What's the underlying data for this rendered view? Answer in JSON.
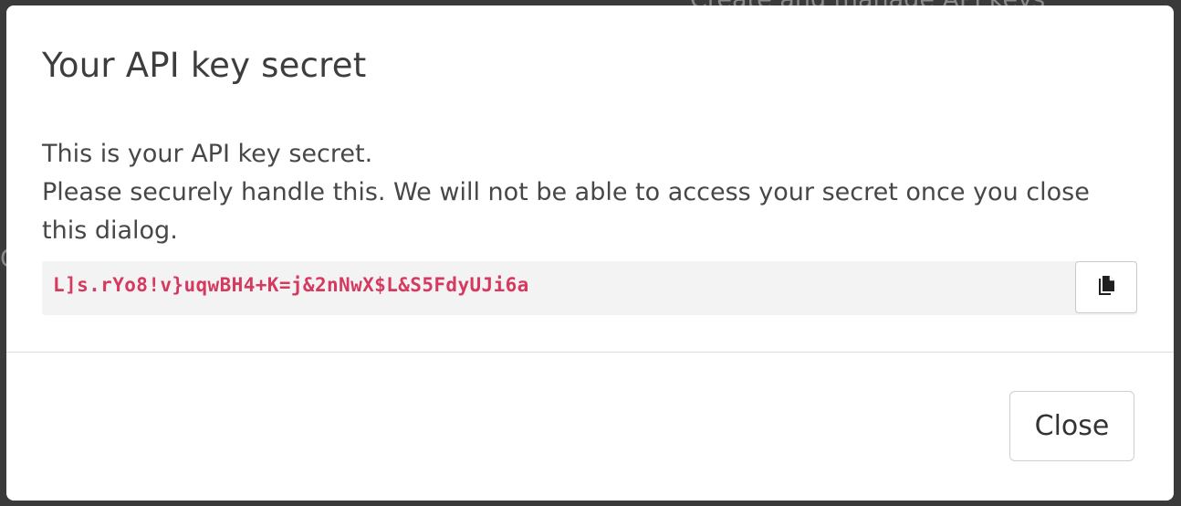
{
  "background": {
    "partial_heading": "Create and manage API keys"
  },
  "dialog": {
    "title": "Your API key secret",
    "description_line1": "This is your API key secret.",
    "description_line2": "Please securely handle this. We will not be able to access your secret once you close this dialog.",
    "secret_value": "L]s.rYo8!v}uqwBH4+K=j&2nNwX$L&S5FdyUJi6a",
    "copy_icon": "copy-icon",
    "close_label": "Close"
  },
  "colors": {
    "secret_text": "#d63960",
    "secret_background": "#f3f3f3",
    "overlay": "#3a3a3a"
  }
}
